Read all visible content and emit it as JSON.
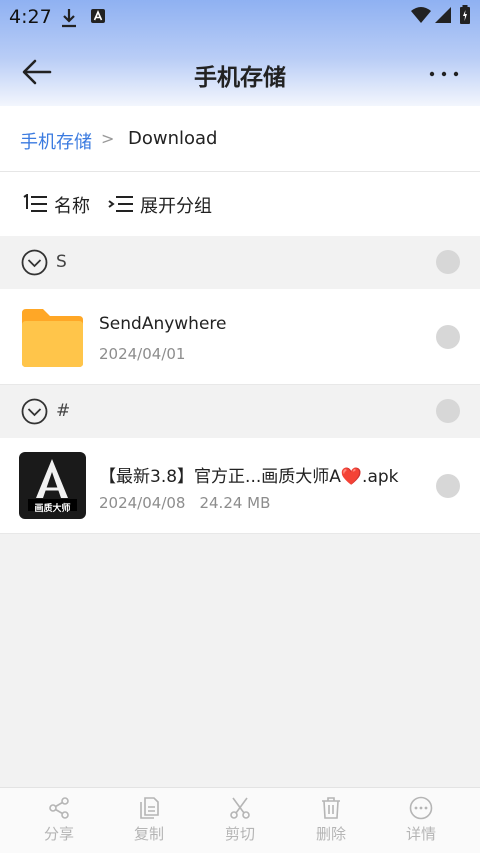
{
  "status_bar": {
    "time": "4:27",
    "left_icons": [
      "download-icon",
      "app-a-icon"
    ],
    "right_icons": [
      "wifi-icon",
      "signal-icon",
      "battery-icon"
    ]
  },
  "app_bar": {
    "title": "手机存储",
    "back_icon": "back-arrow-icon",
    "more_icon": "more-horizontal-icon"
  },
  "breadcrumb": {
    "root": "手机存储",
    "separator": ">",
    "current": "Download"
  },
  "toolbar": {
    "sort_label": "名称",
    "expand_label": "展开分组"
  },
  "groups": [
    {
      "label": "S",
      "items": [
        {
          "name": "SendAnywhere",
          "date": "2024/04/01",
          "size": "",
          "type": "folder"
        }
      ]
    },
    {
      "label": "#",
      "items": [
        {
          "name": "【最新3.8】官方正...画质大师A❤️.apk",
          "date": "2024/04/08",
          "size": "24.24 MB",
          "type": "apk",
          "icon_text": "画质大师"
        }
      ]
    }
  ],
  "bottom_actions": [
    {
      "label": "分享",
      "icon": "share-icon"
    },
    {
      "label": "复制",
      "icon": "copy-icon"
    },
    {
      "label": "剪切",
      "icon": "scissors-icon"
    },
    {
      "label": "删除",
      "icon": "trash-icon"
    },
    {
      "label": "详情",
      "icon": "details-icon"
    }
  ],
  "colors": {
    "accent": "#3b7be0",
    "header_gradient_top": "#8fb1f2",
    "folder": "#ffb52e",
    "disabled": "#b5b5b5"
  }
}
